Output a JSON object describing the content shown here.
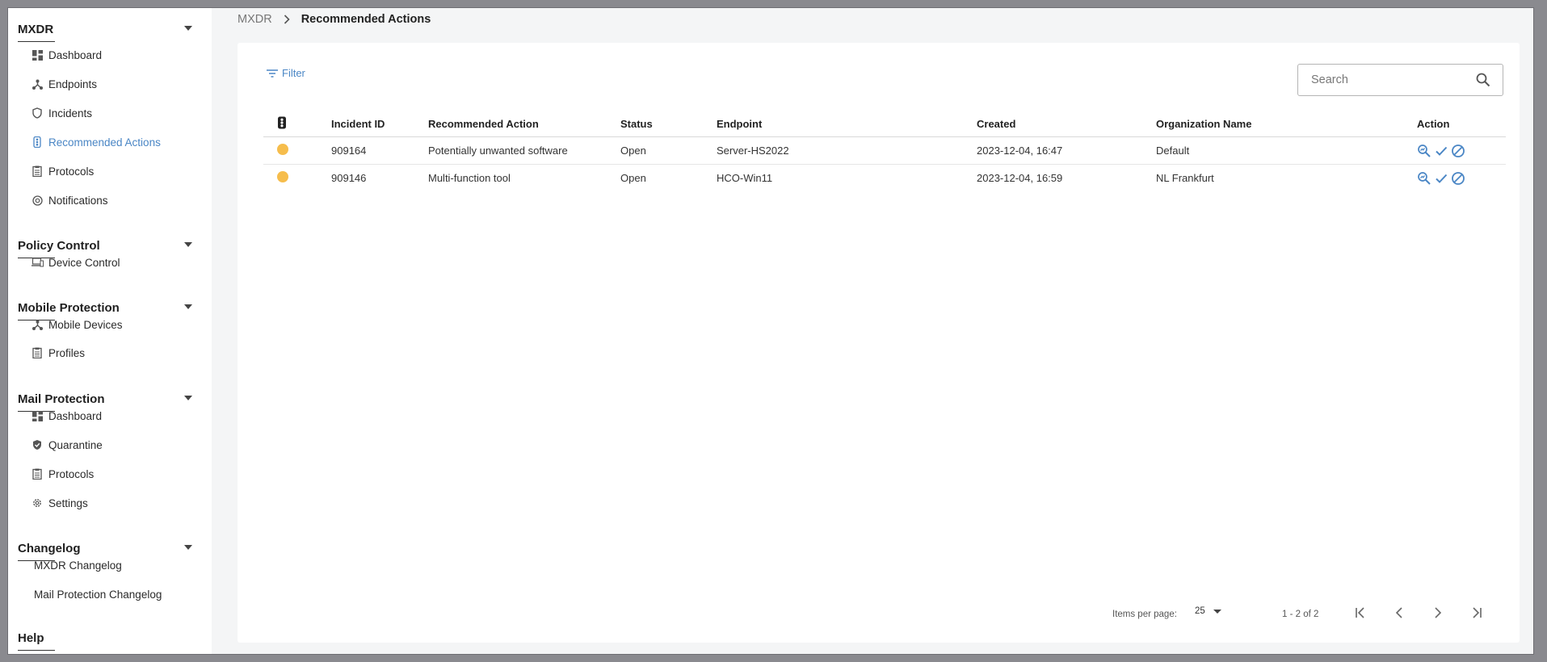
{
  "sidebar": {
    "sections": [
      {
        "title": "MXDR",
        "items": [
          {
            "label": "Dashboard",
            "icon": "dashboard-icon"
          },
          {
            "label": "Endpoints",
            "icon": "network-icon"
          },
          {
            "label": "Incidents",
            "icon": "shield-icon"
          },
          {
            "label": "Recommended Actions",
            "icon": "traffic-light-icon",
            "active": true
          },
          {
            "label": "Protocols",
            "icon": "clipboard-icon"
          },
          {
            "label": "Notifications",
            "icon": "notification-icon"
          }
        ]
      },
      {
        "title": "Policy Control",
        "items": [
          {
            "label": "Device Control",
            "icon": "devices-icon"
          }
        ]
      },
      {
        "title": "Mobile Protection",
        "items": [
          {
            "label": "Mobile Devices",
            "icon": "network-icon"
          },
          {
            "label": "Profiles",
            "icon": "clipboard-icon"
          }
        ]
      },
      {
        "title": "Mail Protection",
        "items": [
          {
            "label": "Dashboard",
            "icon": "dashboard-icon"
          },
          {
            "label": "Quarantine",
            "icon": "shield-check-icon"
          },
          {
            "label": "Protocols",
            "icon": "clipboard-icon"
          },
          {
            "label": "Settings",
            "icon": "gear-icon"
          }
        ]
      },
      {
        "title": "Changelog",
        "items": [
          {
            "label": "MXDR Changelog"
          },
          {
            "label": "Mail Protection Changelog"
          }
        ]
      },
      {
        "title": "Help",
        "items": []
      }
    ]
  },
  "breadcrumb": {
    "root": "MXDR",
    "current": "Recommended Actions"
  },
  "toolbar": {
    "filter_label": "Filter",
    "search_placeholder": "Search"
  },
  "table": {
    "columns": [
      "Incident ID",
      "Recommended Action",
      "Status",
      "Endpoint",
      "Created",
      "Organization Name",
      "Action"
    ],
    "rows": [
      {
        "severity_color": "#f6bd4c",
        "incident_id": "909164",
        "recommended_action": "Potentially unwanted software",
        "status": "Open",
        "endpoint": "Server-HS2022",
        "created": "2023-12-04, 16:47",
        "organization": "Default"
      },
      {
        "severity_color": "#f6bd4c",
        "incident_id": "909146",
        "recommended_action": "Multi-function tool",
        "status": "Open",
        "endpoint": "HCO-Win11",
        "created": "2023-12-04, 16:59",
        "organization": "NL Frankfurt"
      }
    ]
  },
  "pagination": {
    "items_per_page_label": "Items per page:",
    "items_per_page_value": "25",
    "range_label": "1 - 2 of 2"
  },
  "colors": {
    "accent": "#4a86c5",
    "severity_medium": "#f6bd4c"
  }
}
